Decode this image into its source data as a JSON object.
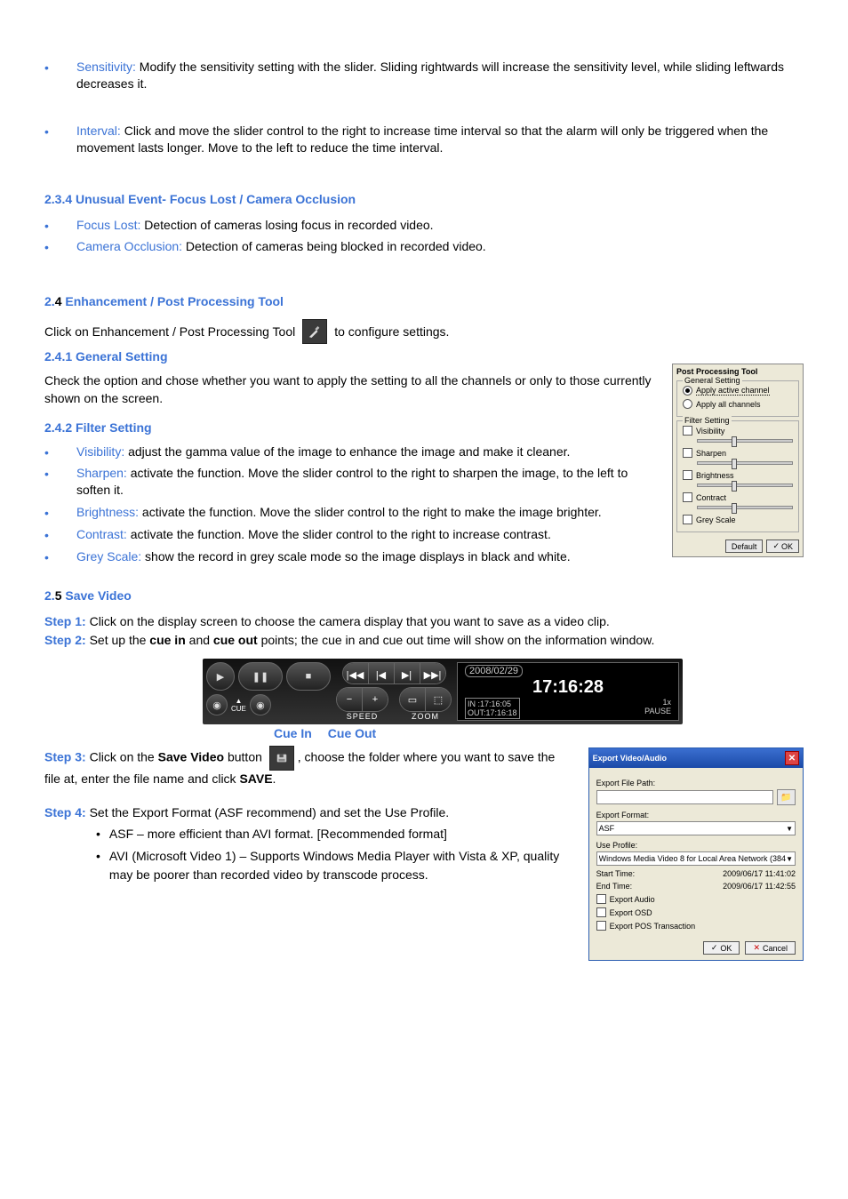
{
  "intro_bullets": [
    {
      "term": "Sensitivity:",
      "body": " Modify the sensitivity setting with the slider.   Sliding rightwards will increase the sensitivity level, while sliding leftwards decreases it."
    },
    {
      "term": "Interval:",
      "body": " Click and move the slider control to the right to increase time interval so that the alarm will only be triggered when the movement lasts longer. Move to the left to reduce the time interval."
    }
  ],
  "h234": "2.3.4 Unusual Event- Focus Lost / Camera Occlusion",
  "b234": [
    {
      "term": "Focus Lost:",
      "body": " Detection of cameras losing focus in recorded video."
    },
    {
      "term": "Camera Occlusion:",
      "body": " Detection of cameras being blocked in recorded video."
    }
  ],
  "h24_n": "2.",
  "h24_4": "4",
  "h24_t": " Enhancement / Post Processing Tool",
  "line24_a": "Click on Enhancement / Post Processing Tool",
  "line24_b": "to configure settings.",
  "h241": "2.4.1 General Setting",
  "p241": "Check the option and chose whether you want to apply the setting to all the channels or only to those currently shown on the screen.",
  "h242": "2.4.2 Filter Setting",
  "b242": [
    {
      "term": "Visibility:",
      "body": " adjust the gamma value of the image to enhance the image and make it cleaner."
    },
    {
      "term": "Sharpen:",
      "body": " activate the function. Move the slider control to the right to sharpen the image, to the left to soften it."
    },
    {
      "term": "Brightness:",
      "body": " activate the function. Move the slider control to the right to make the image brighter."
    },
    {
      "term": "Contrast:",
      "body": " activate the function. Move the slider control to the right to increase contrast."
    },
    {
      "term": "Grey Scale:",
      "body": " show the record in grey scale mode so the image displays in black and white."
    }
  ],
  "ppt": {
    "title": "Post Processing Tool",
    "gs_legend": "General Setting",
    "radio1": "Apply active channel",
    "radio2": "Apply all channels",
    "fs_legend": "Filter Setting",
    "c1": "Visibility",
    "c2": "Sharpen",
    "c3": "Brightness",
    "c4": "Contract",
    "c5": "Grey Scale",
    "btn_default": "Default",
    "btn_ok": "OK"
  },
  "h25_n": "2.",
  "h25_5": "5",
  "h25_t": " Save Video",
  "step1_label": "Step 1:",
  "step1": " Click on the display screen to choose the camera display that you want to save as a video clip.",
  "step2_label": "Step 2:",
  "step2_a": " Set up the ",
  "step2_b": "cue in",
  "step2_c": " and ",
  "step2_d": "cue out",
  "step2_e": " points; the cue in and cue out time will show on the information window.",
  "playback": {
    "date": "2008/02/29",
    "time": "17:16:28",
    "in": "IN :17:16:05",
    "out": "OUT:17:16:18",
    "rate": "1x",
    "pause": "PAUSE",
    "speed": "SPEED",
    "zoom": "ZOOM",
    "cue": "CUE"
  },
  "cuein_lbl": "Cue In",
  "cueout_lbl": "Cue Out",
  "step3_label": "Step 3:",
  "step3_a": " Click on the ",
  "step3_b": "Save Video",
  "step3_c": " button ",
  "step3_d": ", choose the folder where you want to save the file at, enter the file name and click ",
  "step3_e": "SAVE",
  "step3_f": ".",
  "step4_label": "Step 4:",
  "step4": " Set the Export Format (ASF recommend) and set the Use Profile.",
  "step4_b1": "ASF – more efficient than AVI format. [Recommended format]",
  "step4_b2": "AVI (Microsoft Video 1) – Supports Windows Media Player with Vista & XP, quality may be poorer than recorded video by transcode process.",
  "export": {
    "title": "Export Video/Audio",
    "path_lbl": "Export File Path:",
    "fmt_lbl": "Export Format:",
    "fmt_val": "ASF",
    "prof_lbl": "Use Profile:",
    "prof_val": "Windows Media Video 8 for Local Area Network (384",
    "start_lbl": "Start Time:",
    "start_val": "2009/06/17 11:41:02",
    "end_lbl": "End Time:",
    "end_val": "2009/06/17 11:42:55",
    "chk1": "Export Audio",
    "chk2": "Export OSD",
    "chk3": "Export POS Transaction",
    "ok": "OK",
    "cancel": "Cancel"
  }
}
